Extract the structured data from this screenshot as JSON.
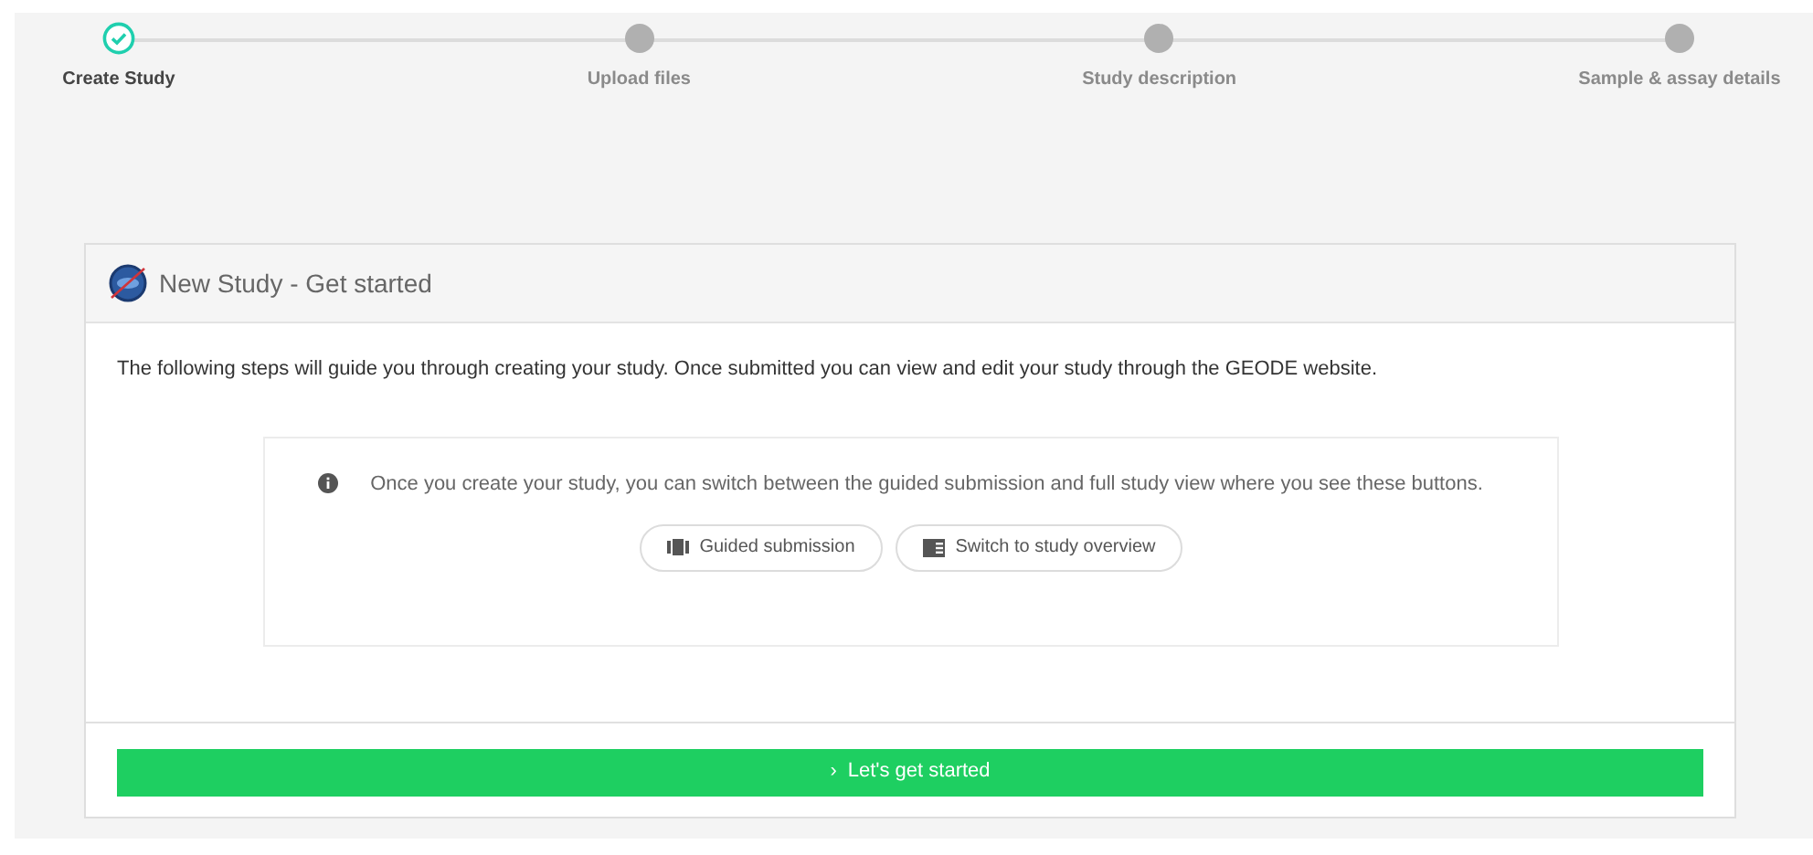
{
  "steps": [
    {
      "label": "Create Study",
      "completed": true
    },
    {
      "label": "Upload files",
      "completed": false
    },
    {
      "label": "Study description",
      "completed": false
    },
    {
      "label": "Sample & assay details",
      "completed": false
    }
  ],
  "card": {
    "title": "New Study - Get started",
    "intro": "The following steps will guide you through creating your study. Once submitted you can view and edit your study through the GEODE website.",
    "note": "Once you create your study, you can switch between the guided submission and full study view where you see these buttons.",
    "buttons": [
      {
        "kind": "guided",
        "label": "Guided submission"
      },
      {
        "kind": "overview",
        "label": "Switch to study overview"
      }
    ],
    "chevron": "›",
    "primary_button": "Let's get started"
  }
}
